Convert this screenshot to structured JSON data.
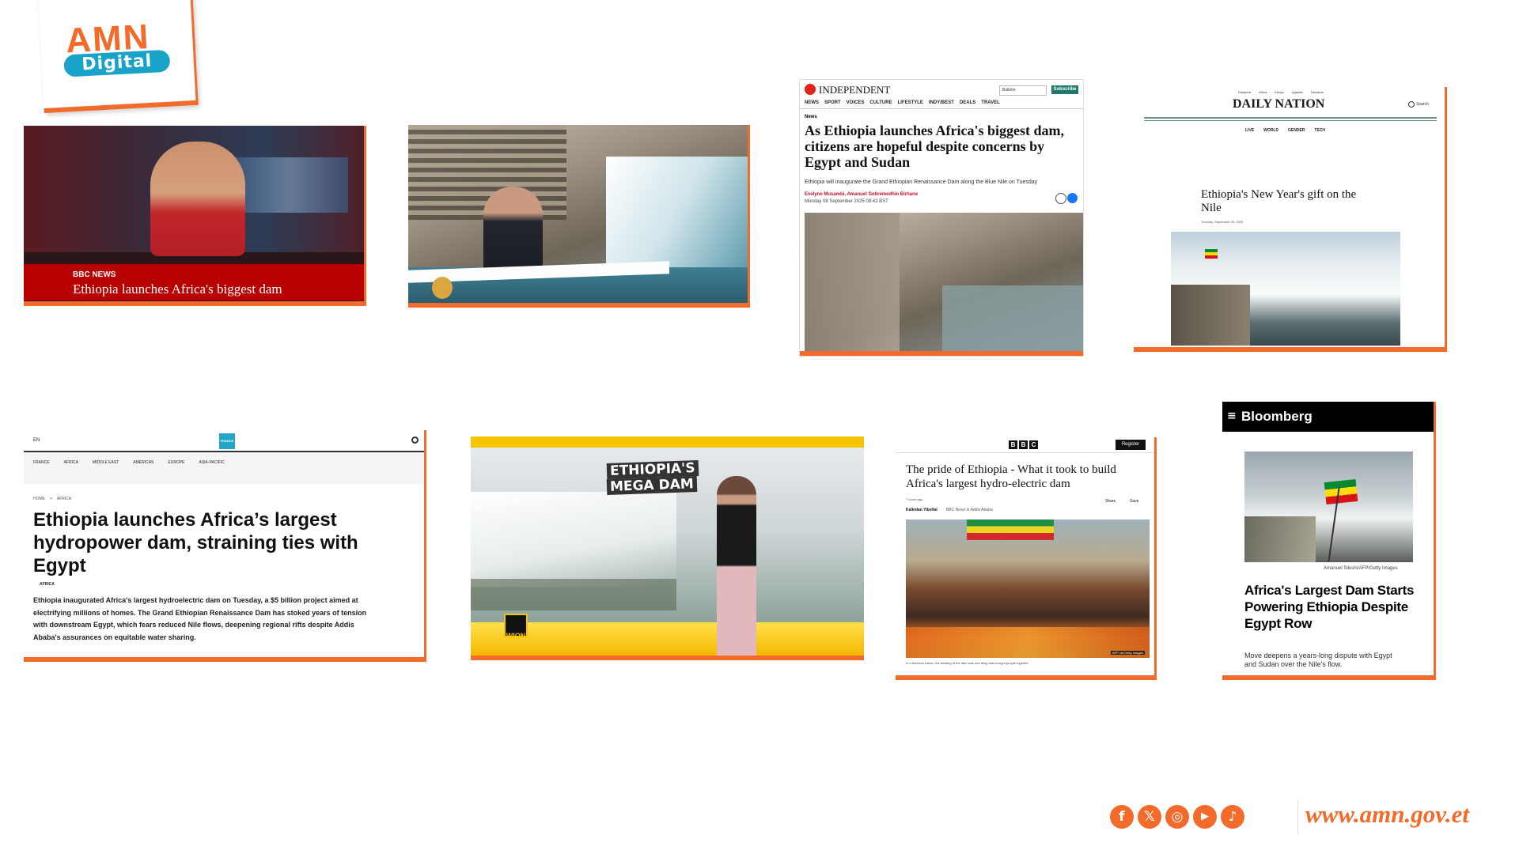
{
  "logo": {
    "brand": "AMN",
    "sub": "Digital"
  },
  "bbc_tv": {
    "network": "BBC NEWS",
    "caption": "Ethiopia launches Africa's biggest dam"
  },
  "independent": {
    "masthead": "INDEPENDENT",
    "search": "Bulletin",
    "subscribe": "Subscribe",
    "nav": [
      "NEWS",
      "SPORT",
      "VOICES",
      "CULTURE",
      "LIFESTYLE",
      "INDY/BEST",
      "DEALS",
      "TRAVEL"
    ],
    "section": "News",
    "headline": "As Ethiopia launches Africa's biggest dam, citizens are hopeful despite concerns by Egypt and Sudan",
    "standfirst": "Ethiopia will inaugurate the Grand Ethiopian Renaissance Dam along the Blue Nile on Tuesday",
    "authors": "Evelyne Musambi, Amanuel Gebremedhin Birhane",
    "date": "Monday 08 September 2025 08:43 BST"
  },
  "nation": {
    "topnav": [
      "Diaspora",
      "Africa",
      "Kenya",
      "Uganda",
      "Tanzania"
    ],
    "masthead": "DAILY NATION",
    "search": "Search",
    "subnav": [
      "LIVE",
      "WORLD",
      "GENDER",
      "TECH"
    ],
    "headline": "Ethiopia's New Year's gift on the Nile",
    "date": "Tuesday, September 09, 2025"
  },
  "france24": {
    "lang": "EN",
    "logo": "FRANCE 24",
    "nav": [
      "FRANCE",
      "AFRICA",
      "MIDDLE EAST",
      "AMERICAS",
      "EUROPE",
      "ASIA-PACIFIC"
    ],
    "breadcrumb_home": "HOME",
    "breadcrumb_sep": ">",
    "breadcrumb_section": "AFRICA",
    "headline": "Ethiopia launches Africa’s largest hydropower dam, straining ties with Egypt",
    "tag": "AFRICA",
    "body": "Ethiopia inaugurated Africa's largest hydroelectric dam on Tuesday, a $5 billion project aimed at electrifying millions of homes. The Grand Ethiopian Renaissance Dam has stoked years of tension with downstream Egypt, which fears reduced Nile flows, deepening regional rifts despite Addis Ababa's assurances on equitable water sharing."
  },
  "wion": {
    "title_line1": "ETHIOPIA'S",
    "title_line2": "MEGA DAM",
    "logo": "WION"
  },
  "bbc_web": {
    "logo_letters": [
      "B",
      "B",
      "C"
    ],
    "register": "Register",
    "headline": "The pride of Ethiopia - What it took to build Africa's largest hydro-electric dam",
    "time": "7 hours ago",
    "author": "Kalkidan Yibeltal",
    "author_role": "BBC News in Addis Ababa",
    "share": "Share",
    "save": "Save",
    "photo_credit": "AFP via Getty Images",
    "caption": "In a fractious nation, the building of the dam was one thing that brought people together"
  },
  "bloomberg": {
    "menu": "≡",
    "brand": "Bloomberg",
    "photo_credit": "Amanuel Sileshi/AFP/Getty Images",
    "headline": "Africa's Largest Dam Starts Powering Ethiopia Despite Egypt Row",
    "dek": "Move deepens a years-long dispute with Egypt and Sudan over the Nile's flow."
  },
  "footer": {
    "social": [
      {
        "icon": "facebook-icon",
        "glyph": "f"
      },
      {
        "icon": "x-icon",
        "glyph": "𝕏"
      },
      {
        "icon": "instagram-icon",
        "glyph": "◎"
      },
      {
        "icon": "youtube-icon",
        "glyph": "▶"
      },
      {
        "icon": "tiktok-icon",
        "glyph": "♪"
      }
    ],
    "url": "www.amn.gov.et"
  },
  "colors": {
    "accent": "#f26b2a",
    "bbc_red": "#b80000",
    "bloomberg_black": "#000000",
    "wion_yellow": "#f5c400"
  }
}
